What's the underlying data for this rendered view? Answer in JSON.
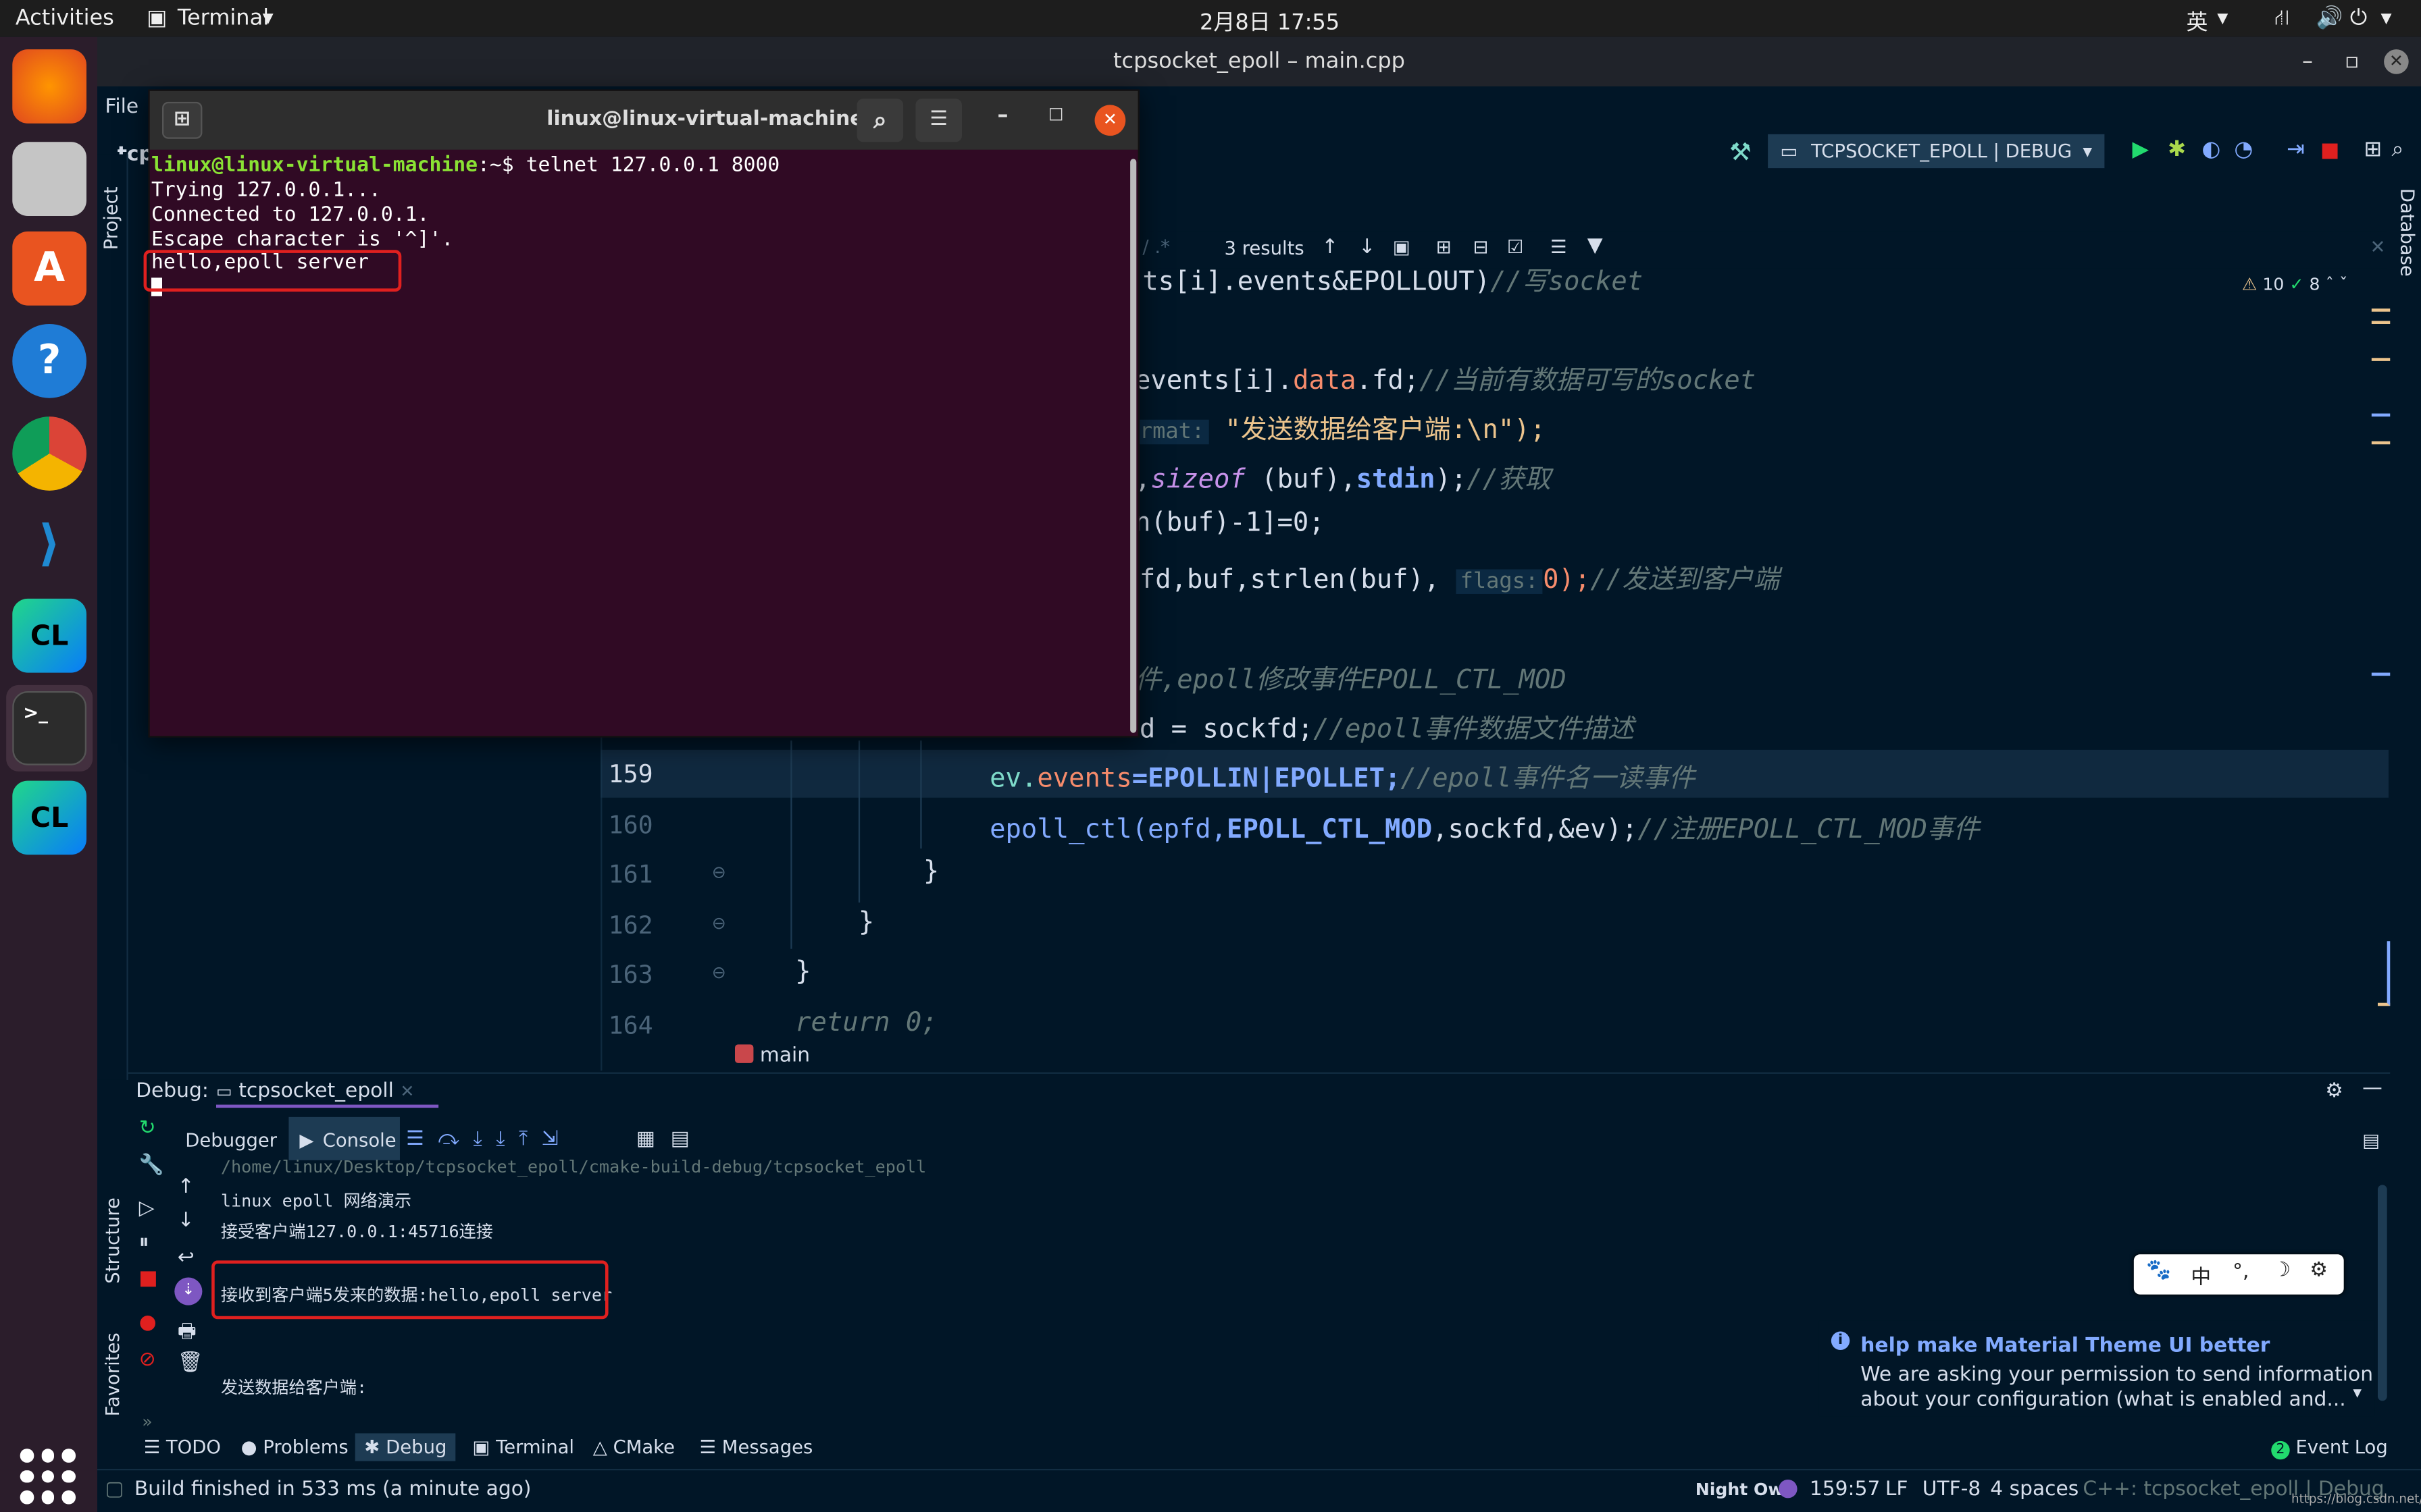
{
  "topbar": {
    "activities": "Activities",
    "app": "Terminal",
    "clock": "2月8日  17:55",
    "ime": "英"
  },
  "ide": {
    "title": "tcpsocket_epoll – main.cpp",
    "menu_file": "File",
    "menu_cut": "tcp",
    "run_config": "TCPSOCKET_EPOLL | DEBUG",
    "side_project": "Project",
    "side_structure": "Structure",
    "side_favorites": "Favorites",
    "side_database": "Database",
    "find_results": "3 results",
    "warn_count": "10",
    "ok_count": "8",
    "breadcrumb": "main",
    "code": {
      "l0_a": "ts[i].events&EPOLLOUT)",
      "l0_c": "//写socket",
      "l1_a": "events[i].",
      "l1_b": "data",
      "l1_c": ".fd;",
      "l1_d": "//当前有数据可写的socket",
      "l2_hint": "rmat:",
      "l2_a": "\"发送数据给客户端:\\n\");",
      "l3_a": ",",
      "l3_b": "sizeof",
      "l3_c": " (buf),",
      "l3_d": "stdin",
      "l3_e": ");",
      "l3_f": "//获取",
      "l4_a": "n(buf)-1]=0;",
      "l5_a": "fd,buf,strlen(buf),",
      "l5_hint": "flags:",
      "l5_b": "0);",
      "l5_c": "//发送到客户端",
      "l6_a": "件,epoll修改事件EPOLL_CTL_MOD",
      "l7_a": "d = sockfd;",
      "l7_c": "//epoll事件数据文件描述",
      "l8_n": "159",
      "l8_a": "ev.",
      "l8_b": "events",
      "l8_c": "=EPOLLIN|EPOLLET;",
      "l8_d": "//epoll事件名一读事件",
      "l9_n": "160",
      "l9_a": "epoll_ctl(epfd,",
      "l9_b": "EPOLL_CTL_MOD",
      "l9_c": ",sockfd,&ev);",
      "l9_d": "//注册EPOLL_CTL_MOD事件",
      "l10_n": "161",
      "l10_a": "}",
      "l11_n": "162",
      "l11_a": "}",
      "l12_n": "163",
      "l12_a": "}",
      "l13_n": "164",
      "l13_a": "return 0;"
    },
    "debug": {
      "label": "Debug:",
      "session": "tcpsocket_epoll",
      "tab_debugger": "Debugger",
      "tab_console": "Console",
      "console": [
        "/home/linux/Desktop/tcpsocket_epoll/cmake-build-debug/tcpsocket_epoll",
        "linux epoll 网络演示",
        "接受客户端127.0.0.1:45716连接",
        "接收到客户端5发来的数据:hello,epoll server",
        "发送数据给客户端:"
      ]
    },
    "bottom_tabs": {
      "todo": "TODO",
      "problems": "Problems",
      "debug": "Debug",
      "terminal": "Terminal",
      "cmake": "CMake",
      "messages": "Messages",
      "event_log": "Event Log",
      "event_count": "2"
    },
    "status": {
      "build": "Build finished in 533 ms (a minute ago)",
      "theme": "Night Owl",
      "pos": "159:57",
      "lf": "LF",
      "enc": "UTF-8",
      "indent": "4 spaces",
      "ctx": "C++: tcpsocket_epoll | Debug",
      "watermark": "https://blog.csdn.net/weixin_"
    },
    "notification": {
      "title": "help make Material Theme UI better",
      "body1": "We are asking your permission to send information",
      "body2": "about your configuration (what is enabled and..."
    },
    "ime_bar": {
      "zh": "中",
      "punct": "°,"
    }
  },
  "terminal": {
    "title": "linux@linux-virtual-machine: ~",
    "prompt_user": "linux@linux-virtual-machine",
    "prompt_rest": ":~$ telnet 127.0.0.1 8000",
    "lines": [
      "Trying 127.0.0.1...",
      "Connected to 127.0.0.1.",
      "Escape character is '^]'.",
      "hello,epoll server"
    ]
  },
  "colors": {
    "accent": "#e0201f",
    "bg": "#011627",
    "terminal": "#300a24"
  }
}
